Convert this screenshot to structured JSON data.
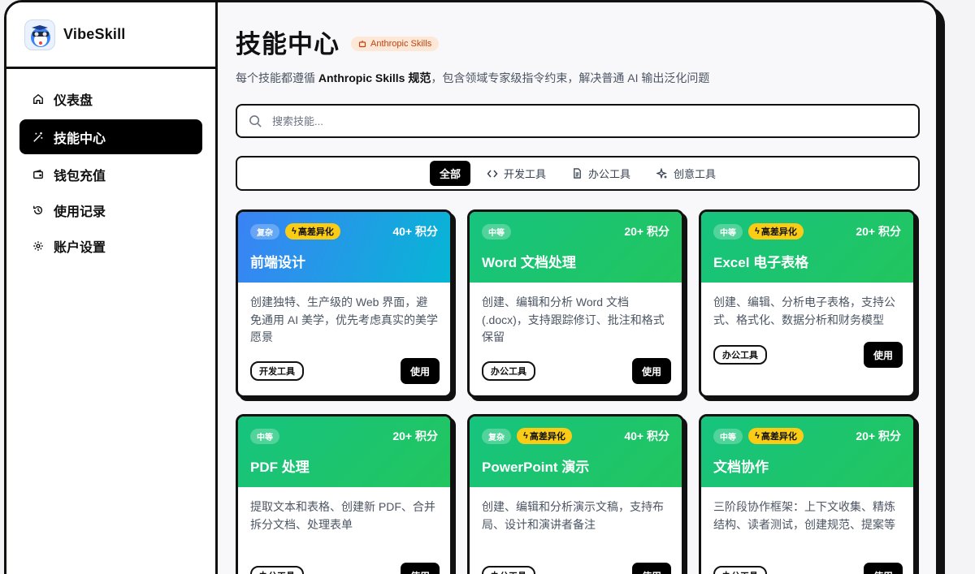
{
  "brand": {
    "name": "VibeSkill"
  },
  "sidebar": {
    "items": [
      {
        "label": "仪表盘",
        "icon": "home-icon"
      },
      {
        "label": "技能中心",
        "icon": "wand-icon",
        "active": true
      },
      {
        "label": "钱包充值",
        "icon": "wallet-icon"
      },
      {
        "label": "使用记录",
        "icon": "history-icon"
      },
      {
        "label": "账户设置",
        "icon": "gear-icon"
      }
    ]
  },
  "header": {
    "title": "技能中心",
    "badge": "Anthropic Skills",
    "subtitle_pre": "每个技能都遵循 ",
    "subtitle_bold": "Anthropic Skills 规范",
    "subtitle_post": "，包含领域专家级指令约束，解决普通 AI 输出泛化问题"
  },
  "search": {
    "placeholder": "搜索技能...",
    "value": ""
  },
  "filters": [
    {
      "label": "全部",
      "active": true
    },
    {
      "label": "开发工具",
      "icon": "code-icon"
    },
    {
      "label": "办公工具",
      "icon": "document-icon"
    },
    {
      "label": "创意工具",
      "icon": "sparkle-icon"
    }
  ],
  "cards": [
    {
      "level": "复杂",
      "diff": "高差异化",
      "points": "40+ 积分",
      "title": "前端设计",
      "desc": "创建独特、生产级的 Web 界面，避免通用 AI 美学，优先考虑真实的美学愿景",
      "tag": "开发工具",
      "button": "使用",
      "color": "blue"
    },
    {
      "level": "中等",
      "diff": "",
      "points": "20+ 积分",
      "title": "Word 文档处理",
      "desc": "创建、编辑和分析 Word 文档 (.docx)，支持跟踪修订、批注和格式保留",
      "tag": "办公工具",
      "button": "使用",
      "color": "green"
    },
    {
      "level": "中等",
      "diff": "高差异化",
      "points": "20+ 积分",
      "title": "Excel 电子表格",
      "desc": "创建、编辑、分析电子表格，支持公式、格式化、数据分析和财务模型",
      "tag": "办公工具",
      "button": "使用",
      "color": "green"
    },
    {
      "level": "中等",
      "diff": "",
      "points": "20+ 积分",
      "title": "PDF 处理",
      "desc": "提取文本和表格、创建新 PDF、合并拆分文档、处理表单",
      "tag": "办公工具",
      "button": "使用",
      "color": "green"
    },
    {
      "level": "复杂",
      "diff": "高差异化",
      "points": "40+ 积分",
      "title": "PowerPoint 演示",
      "desc": "创建、编辑和分析演示文稿，支持布局、设计和演讲者备注",
      "tag": "办公工具",
      "button": "使用",
      "color": "green"
    },
    {
      "level": "中等",
      "diff": "高差异化",
      "points": "20+ 积分",
      "title": "文档协作",
      "desc": "三阶段协作框架：上下文收集、精炼结构、读者测试，创建规范、提案等",
      "tag": "办公工具",
      "button": "使用",
      "color": "green"
    }
  ]
}
